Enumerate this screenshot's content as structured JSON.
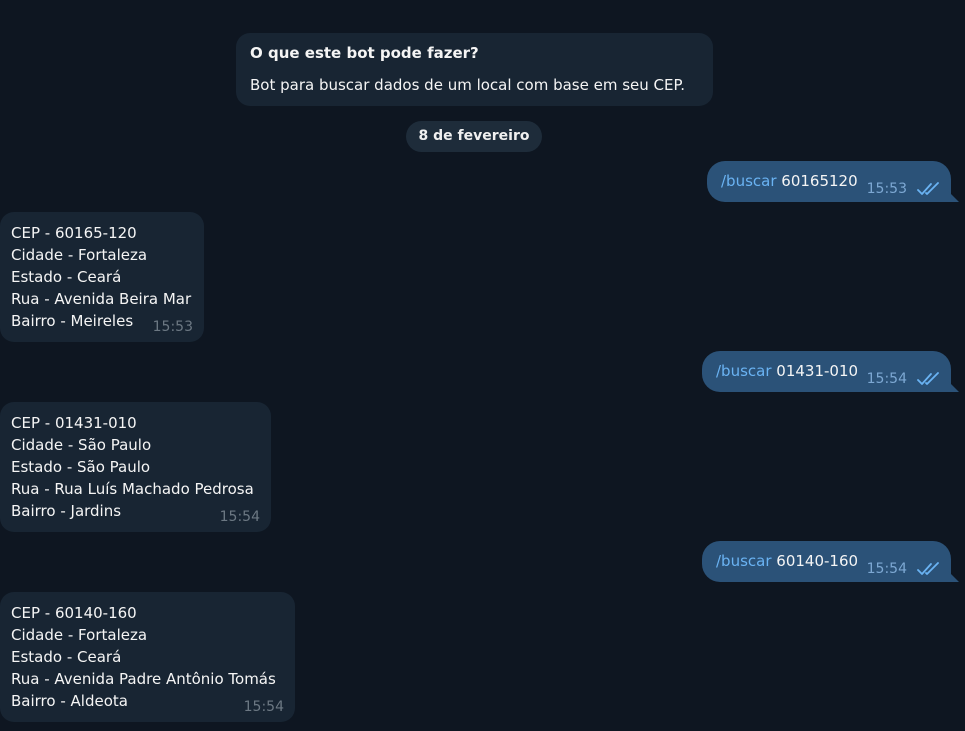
{
  "intro": {
    "title": "O que este bot pode fazer?",
    "text": "Bot para buscar dados de um local com base em seu CEP."
  },
  "date_separator": "8 de fevereiro",
  "messages": [
    {
      "type": "outgoing",
      "command": "/buscar",
      "arg": "60165120",
      "time": "15:53",
      "status": "read"
    },
    {
      "type": "incoming",
      "lines": [
        "CEP - 60165-120",
        "Cidade - Fortaleza",
        "Estado - Ceará",
        "Rua - Avenida Beira Mar",
        "Bairro - Meireles"
      ],
      "time": "15:53"
    },
    {
      "type": "outgoing",
      "command": "/buscar",
      "arg": "01431-010",
      "time": "15:54",
      "status": "read"
    },
    {
      "type": "incoming",
      "lines": [
        "CEP - 01431-010",
        "Cidade - São Paulo",
        "Estado - São Paulo",
        "Rua - Rua Luís Machado Pedrosa",
        "Bairro - Jardins"
      ],
      "time": "15:54"
    },
    {
      "type": "outgoing",
      "command": "/buscar",
      "arg": "60140-160",
      "time": "15:54",
      "status": "read"
    },
    {
      "type": "incoming",
      "lines": [
        "CEP - 60140-160",
        "Cidade - Fortaleza",
        "Estado - Ceará",
        "Rua - Avenida Padre Antônio Tomás",
        "Bairro - Aldeota"
      ],
      "time": "15:54"
    }
  ],
  "colors": {
    "background": "#0e1621",
    "incoming_bubble": "#182533",
    "outgoing_bubble": "#2b5278",
    "command_link": "#6ab3f3",
    "read_ticks": "#6ab3f3"
  },
  "icons": {
    "read_status": "double-check-icon"
  }
}
